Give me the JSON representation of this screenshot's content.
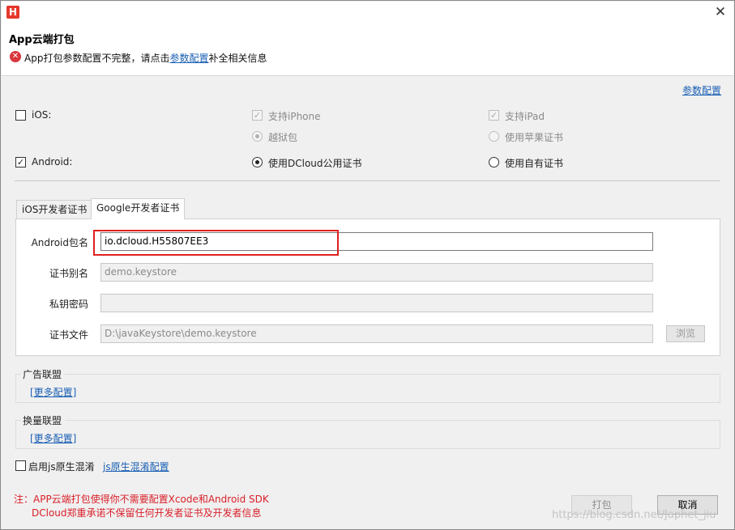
{
  "window": {
    "logo_glyph": "H",
    "close_glyph": "✕"
  },
  "header": {
    "title": "App云端打包",
    "error_icon_glyph": "✕",
    "error_text_before": "App打包参数配置不完整，请点击",
    "error_link": "参数配置",
    "error_text_after": "补全相关信息"
  },
  "top_link": "参数配置",
  "platforms": {
    "ios": {
      "label": "iOS:",
      "checked": false,
      "iphone_label": "支持iPhone",
      "ipad_label": "支持iPad",
      "jailbreak_label": "越狱包",
      "apple_cert_label": "使用苹果证书"
    },
    "android": {
      "label": "Android:",
      "checked": true,
      "dcloud_cert_label": "使用DCloud公用证书",
      "own_cert_label": "使用自有证书"
    }
  },
  "tabs": [
    {
      "label": "iOS开发者证书",
      "active": false
    },
    {
      "label": "Google开发者证书",
      "active": true
    }
  ],
  "form": {
    "package_label": "Android包名",
    "package_value": "io.dcloud.H55807EE3",
    "alias_label": "证书别名",
    "alias_value": "demo.keystore",
    "password_label": "私钥密码",
    "password_value": "",
    "file_label": "证书文件",
    "file_value": "D:\\javaKeystore\\demo.keystore",
    "browse_label": "浏览"
  },
  "ad_union": {
    "title": "广告联盟",
    "link": "[更多配置]"
  },
  "swap_union": {
    "title": "换量联盟",
    "link": "[更多配置]"
  },
  "obfuscation": {
    "checkbox_label": "启用js原生混淆",
    "link": "js原生混淆配置"
  },
  "notes": {
    "line1": "注：APP云端打包使得你不需要配置Xcode和Android SDK",
    "line2": "DCloud郑重承诺不保留任何开发者证书及开发者信息"
  },
  "buttons": {
    "pack": "打包",
    "cancel": "取消"
  },
  "watermark": "https://blog.csdn.net/Japhet_jiu",
  "colors": {
    "accent_link": "#1a5fb4",
    "error_red": "#d9363e",
    "highlight_red": "#e02020",
    "note_red": "#d9202a"
  }
}
